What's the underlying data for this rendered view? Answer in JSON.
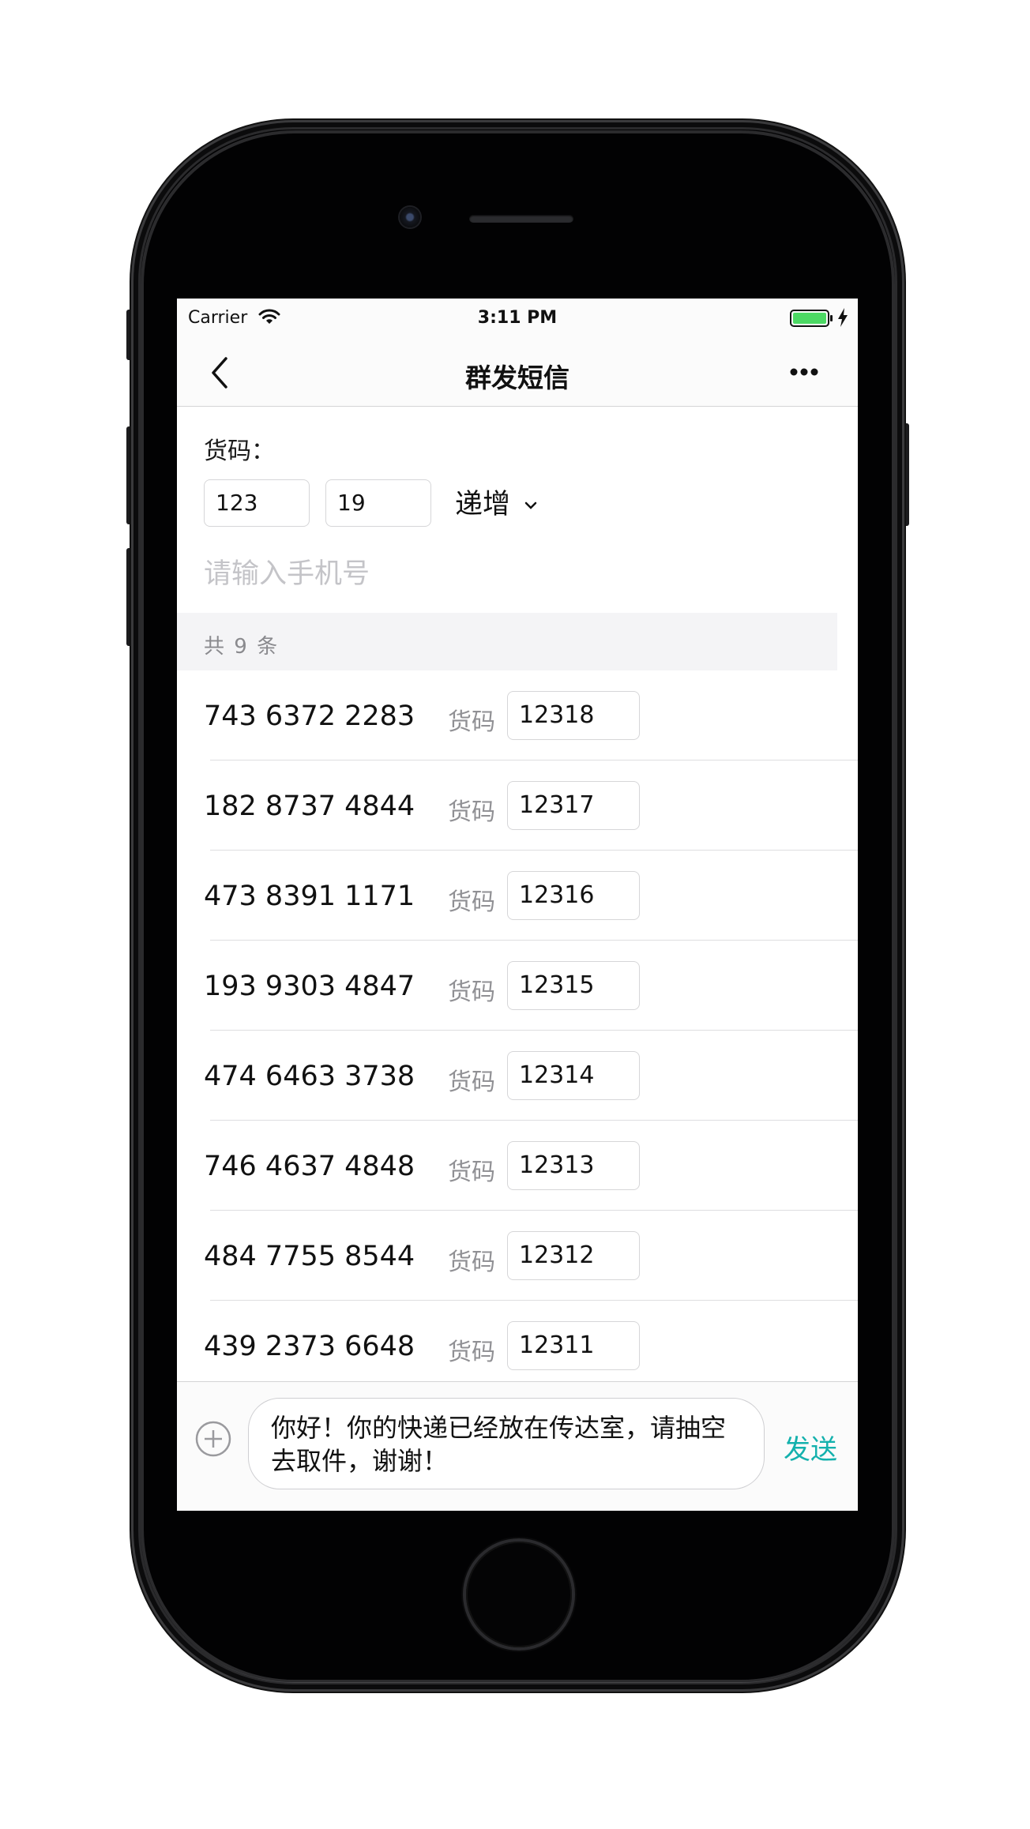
{
  "status_bar": {
    "carrier": "Carrier",
    "time": "3:11 PM",
    "battery_color": "#4cd964"
  },
  "nav": {
    "title": "群发短信"
  },
  "form": {
    "code_label": "货码：",
    "code_start": "123",
    "code_step": "19",
    "mode": "递增",
    "phone_placeholder": "请输入手机号"
  },
  "summary": {
    "count_text": "共 9 条"
  },
  "list": {
    "code_label": "货码",
    "rows": [
      {
        "phone": "743 6372 2283",
        "code": "12318"
      },
      {
        "phone": "182 8737 4844",
        "code": "12317"
      },
      {
        "phone": "473 8391 1171",
        "code": "12316"
      },
      {
        "phone": "193 9303 4847",
        "code": "12315"
      },
      {
        "phone": "474 6463 3738",
        "code": "12314"
      },
      {
        "phone": "746 4637 4848",
        "code": "12313"
      },
      {
        "phone": "484 7755 8544",
        "code": "12312"
      },
      {
        "phone": "439 2373 6648",
        "code": "12311"
      }
    ]
  },
  "compose": {
    "message": "你好！你的快递已经放在传达室，请抽空去取件，谢谢！",
    "send_label": "发送",
    "accent_color": "#14b1ad"
  }
}
